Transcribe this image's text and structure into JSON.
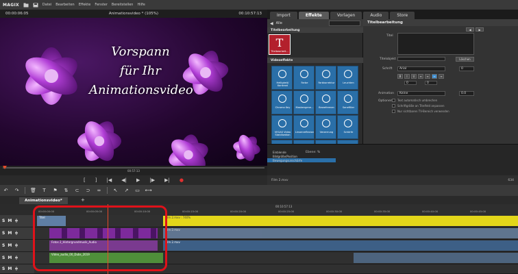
{
  "menubar": {
    "logo": "MAGIX",
    "items": [
      "Datei",
      "Bearbeiten",
      "Effekte",
      "Fenster",
      "Bereitstellen",
      "Hilfe"
    ]
  },
  "preview": {
    "timecode_left": "00:00:06:05",
    "title": "Animationsvideo * (105%)",
    "timecode_right": "00:10:57:13",
    "overlay_lines": [
      "Vorspann",
      "für Ihr",
      "Animationsvideo"
    ],
    "scrub_timecode": "00:57:13"
  },
  "tabs": [
    "Import",
    "Effekte",
    "Vorlagen",
    "Audio",
    "Store"
  ],
  "active_tab": "Effekte",
  "fx": {
    "filter": "Alle",
    "section_title": "Titelbearbeitung",
    "title_tile_label": "Titelbearbeit...",
    "section_video": "Videoeffekte",
    "tiles": [
      {
        "label": "Helligkeit/ Kontrast",
        "icon": "sun-icon"
      },
      {
        "label": "Farbe",
        "icon": "palette-icon"
      },
      {
        "label": "Farbkorrektur",
        "icon": "color-wheel-icon"
      },
      {
        "label": "Leuchten",
        "icon": "glow-icon"
      },
      {
        "label": "Chroma Key",
        "icon": "chroma-icon"
      },
      {
        "label": "Maskengene...",
        "icon": "mask-icon"
      },
      {
        "label": "Bewefremen",
        "icon": "motion-icon"
      },
      {
        "label": "Sanefilter",
        "icon": "filter-icon"
      },
      {
        "label": "VEGAS Video Stabilization",
        "icon": "stabilize-icon"
      },
      {
        "label": "Linsenreflexion",
        "icon": "lens-flare-icon"
      },
      {
        "label": "Verzerrung",
        "icon": "distort-icon"
      },
      {
        "label": "Schärfe",
        "icon": "sharpen-icon"
      },
      {
        "label": "",
        "icon": "effect-icon"
      },
      {
        "label": "",
        "icon": "effect-icon"
      },
      {
        "label": "",
        "icon": "effect-icon"
      },
      {
        "label": "",
        "icon": "effect-icon"
      }
    ]
  },
  "title_editor": {
    "header": "Titelbearbeitung",
    "text_label": "Titel",
    "object_label": "Titelobjekt",
    "delete_button": "Löschen",
    "font_label": "Schrift",
    "font_value": "Arial",
    "size_value": "0",
    "style_values": [
      "0",
      "0"
    ],
    "animation_label": "Animation",
    "animation_value": "Keine",
    "animation_number": "0.0",
    "options_label": "Optionen",
    "options": [
      "Text automatisch umbrechen",
      "Schriftgröße an Titelfeld anpassen",
      "Nur sichtbaren TV-Bereich verwenden"
    ]
  },
  "keyframes": {
    "rows": [
      "Einblende",
      "Bildgröße/Position",
      "Bewegungsunschärfe"
    ],
    "right_label": "Ebene: %"
  },
  "right_footer": {
    "file": "Film 2.mxv",
    "zoom": "634"
  },
  "timeline": {
    "project_tab": "Animationsvideo*",
    "ruler_ticks": [
      "00:00:00:00",
      "00:00:05:00",
      "00:00:10:00",
      "00:00:15:00",
      "00:00:20:00",
      "00:00:25:00",
      "00:00:30:00",
      "00:00:35:00",
      "00:00:40:00",
      "00:00:45:00"
    ],
    "top_timecode": "00:10:57:13",
    "tracks": [
      {
        "clips": [
          "Titel",
          "Film 2.mxv : 740%"
        ]
      },
      {
        "clips": [
          "Film 2.mxv"
        ]
      },
      {
        "clips": [
          "Fotos 2_Hintergrundmusik_Audio",
          "Film 2.mxv"
        ]
      },
      {
        "clips": [
          "Video_audio_00_Dubs_2019"
        ]
      },
      {
        "clips": [
          ""
        ]
      }
    ]
  }
}
